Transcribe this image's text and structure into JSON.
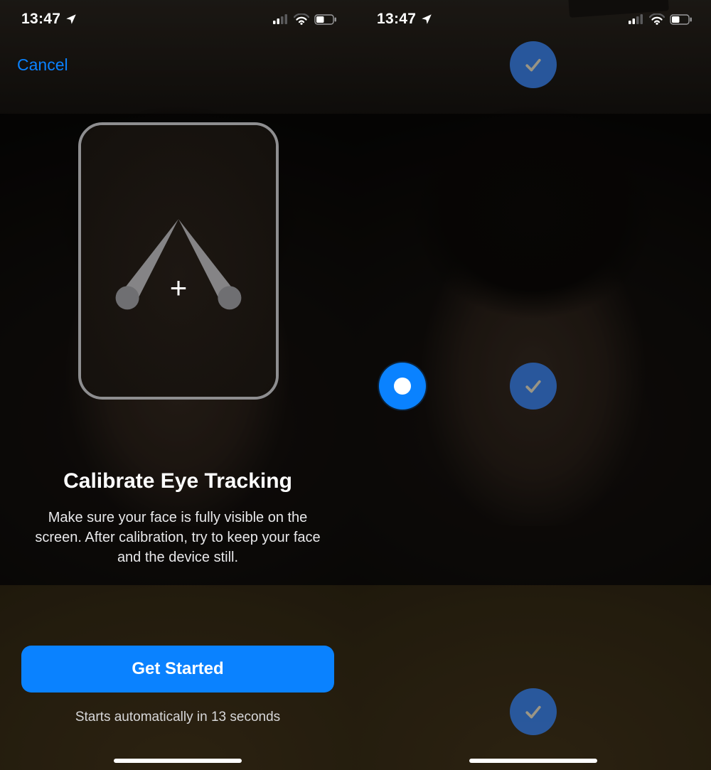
{
  "status": {
    "time": "13:47",
    "location_services": true,
    "signal_strength": 2,
    "wifi": true,
    "battery_percent": 45
  },
  "left": {
    "cancel_label": "Cancel",
    "title": "Calibrate Eye Tracking",
    "description": "Make sure your face is fully visible on the screen. After calibration, try to keep your face and the device still.",
    "primary_button_label": "Get Started",
    "auto_start_prefix": "Starts automatically in ",
    "auto_start_seconds": 13,
    "auto_start_suffix": " seconds",
    "guide_plus": "+"
  },
  "right": {
    "calibration_points": [
      {
        "position": "top",
        "state": "done"
      },
      {
        "position": "center",
        "state": "done"
      },
      {
        "position": "left",
        "state": "active"
      },
      {
        "position": "bottom",
        "state": "done"
      }
    ]
  },
  "colors": {
    "accent": "#0a82ff",
    "done_dot": "#2a5da8",
    "guide_frame": "#8e8e90"
  }
}
